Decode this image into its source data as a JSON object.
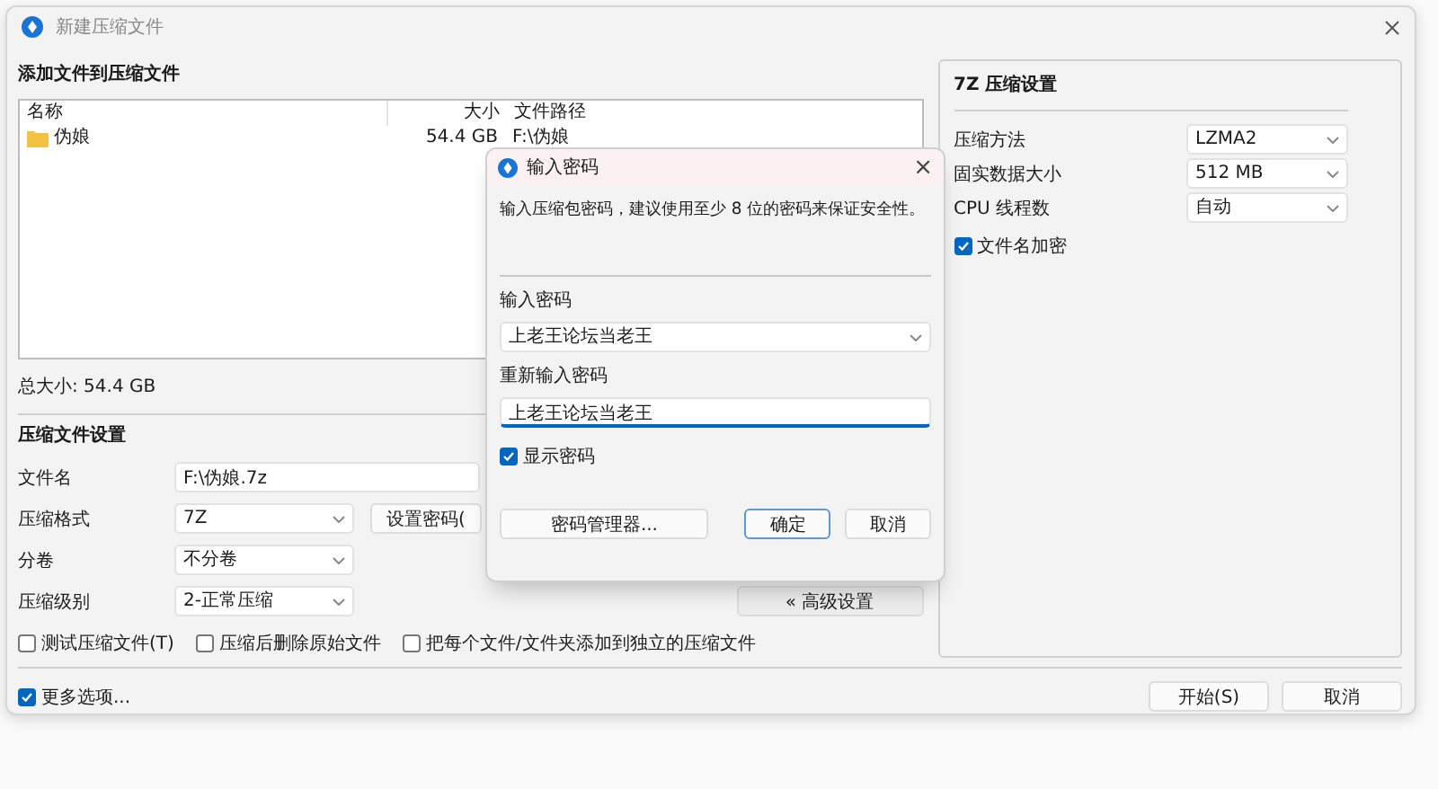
{
  "window": {
    "title": "新建压缩文件"
  },
  "files": {
    "heading": "添加文件到压缩文件",
    "columns": [
      "名称",
      "大小",
      "文件路径"
    ],
    "rows": [
      {
        "name": "伪娘",
        "size": "54.4 GB",
        "path": "F:\\伪娘"
      }
    ],
    "total": "总大小: 54.4 GB"
  },
  "settings": {
    "heading": "压缩文件设置",
    "fields": [
      {
        "label": "文件名",
        "kind": "text",
        "value": "F:\\伪娘.7z"
      },
      {
        "label": "压缩格式",
        "kind": "dropdown",
        "value": "7Z"
      },
      {
        "label": "分卷",
        "kind": "dropdown",
        "value": "不分卷"
      },
      {
        "label": "压缩级别",
        "kind": "dropdown",
        "value": "2-正常压缩"
      }
    ],
    "password_button": "设置密码(",
    "advanced_button": "« 高级设置",
    "options": [
      {
        "label": "测试压缩文件(T)",
        "checked": false
      },
      {
        "label": "压缩后删除原始文件",
        "checked": false
      },
      {
        "label": "把每个文件/文件夹添加到独立的压缩文件",
        "checked": false
      }
    ]
  },
  "seven_zip": {
    "heading": "7Z 压缩设置",
    "fields": [
      {
        "label": "压缩方法",
        "value": "LZMA2"
      },
      {
        "label": "固实数据大小",
        "value": "512 MB"
      },
      {
        "label": "CPU 线程数",
        "value": "自动"
      }
    ],
    "options": [
      {
        "label": "文件名加密",
        "checked": true
      }
    ]
  },
  "more_options": {
    "label": "更多选项...",
    "checked": true
  },
  "buttons": [
    "开始(S)",
    "取消"
  ],
  "password_dialog": {
    "title": "输入密码",
    "close": "×",
    "message": "输入压缩包密码，建议使用至少 8 位的密码来保证安全性。",
    "password_label": "输入密码",
    "password": "上老王论坛当老王",
    "confirm_label": "重新输入密码",
    "confirm": "上老王论坛当老王",
    "show_password": {
      "label": "显示密码",
      "checked": true
    },
    "buttons": [
      {
        "label": "密码管理器...",
        "kind": "wide"
      },
      {
        "label": "确定",
        "kind": "default"
      },
      {
        "label": "取消",
        "kind": "normal"
      }
    ]
  }
}
